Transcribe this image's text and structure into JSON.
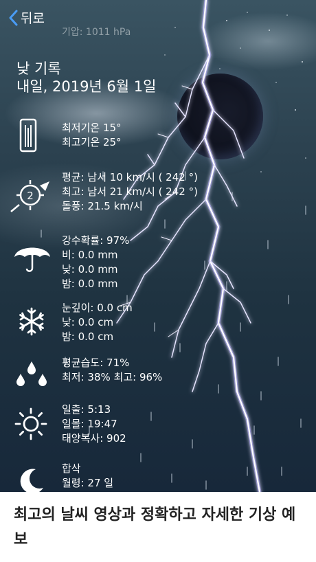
{
  "nav": {
    "back_label": "뒤로"
  },
  "pressure_line": "기압: 1011 hPa",
  "header": {
    "title": "낮 기록",
    "date": "내일, 2019년 6월 1일"
  },
  "temperature": {
    "min": "최저기온 15°",
    "max": "최고기온 25°"
  },
  "wind": {
    "average": "평균: 남서 10 km/시 ( 242 °)",
    "max": "최고: 남서 21 km/시 ( 242 °)",
    "gust": "돌풍: 21.5 km/시",
    "force_number": "2"
  },
  "precipitation": {
    "probability": "강수확률: 97%",
    "rain": "비: 0.0 mm",
    "day": "낮: 0.0 mm",
    "night": "밤: 0.0 mm"
  },
  "snow": {
    "depth": "눈깊이: 0.0 cm",
    "day": "낮: 0.0 cm",
    "night": "밤: 0.0 cm"
  },
  "humidity": {
    "average": "평균습도: 71%",
    "min_max": "최저: 38%  최고: 96%"
  },
  "sun": {
    "sunrise": "일출: 5:13",
    "sunset": "일몰: 19:47",
    "radiation": "태양복사: 902"
  },
  "moon": {
    "phase": "합삭",
    "age": "월령: 27 일"
  },
  "promo": {
    "text": "최고의 날씨 영상과 정확하고 자세한 기상 예보"
  },
  "icons": [
    "chevron-left-icon",
    "thermometer-icon",
    "wind-compass-icon",
    "umbrella-icon",
    "snowflake-icon",
    "water-drops-icon",
    "sun-icon",
    "crescent-moon-icon"
  ]
}
